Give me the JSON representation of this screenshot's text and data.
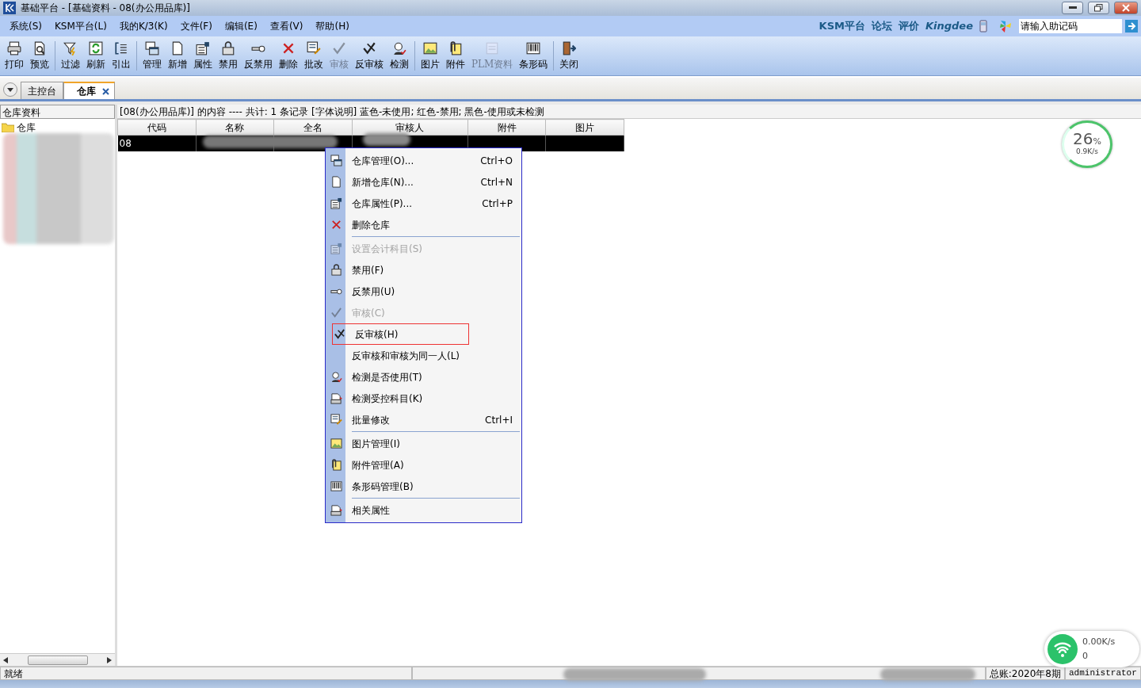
{
  "window": {
    "title": "基础平台 - [基础资料 - 08(办公用品库)]"
  },
  "menu_bar": [
    "系统(S)",
    "KSM平台(L)",
    "我的K/3(K)",
    "文件(F)",
    "编辑(E)",
    "查看(V)",
    "帮助(H)"
  ],
  "top_links": [
    "KSM平台",
    "论坛",
    "评价",
    "Kingdee"
  ],
  "mnemonic_field": {
    "value": "请输入助记码"
  },
  "toolbar": [
    {
      "kind": "button",
      "label": "打印",
      "disabled": false
    },
    {
      "kind": "button",
      "label": "预览",
      "disabled": false
    },
    {
      "kind": "separator"
    },
    {
      "kind": "button",
      "label": "过滤",
      "disabled": false
    },
    {
      "kind": "button",
      "label": "刷新",
      "disabled": false
    },
    {
      "kind": "button",
      "label": "引出",
      "disabled": false
    },
    {
      "kind": "separator"
    },
    {
      "kind": "button",
      "label": "管理",
      "disabled": false
    },
    {
      "kind": "button",
      "label": "新增",
      "disabled": false
    },
    {
      "kind": "button",
      "label": "属性",
      "disabled": false
    },
    {
      "kind": "button",
      "label": "禁用",
      "disabled": false
    },
    {
      "kind": "button",
      "label": "反禁用",
      "disabled": false
    },
    {
      "kind": "button",
      "label": "删除",
      "disabled": false
    },
    {
      "kind": "button",
      "label": "批改",
      "disabled": false
    },
    {
      "kind": "button",
      "label": "审核",
      "disabled": true
    },
    {
      "kind": "button",
      "label": "反审核",
      "disabled": false
    },
    {
      "kind": "button",
      "label": "检测",
      "disabled": false
    },
    {
      "kind": "separator"
    },
    {
      "kind": "button",
      "label": "图片",
      "disabled": false
    },
    {
      "kind": "button",
      "label": "附件",
      "disabled": false
    },
    {
      "kind": "button",
      "label": "PLM资料",
      "disabled": true
    },
    {
      "kind": "button",
      "label": "条形码",
      "disabled": false
    },
    {
      "kind": "separator"
    },
    {
      "kind": "button",
      "label": "关闭",
      "disabled": false
    }
  ],
  "tabs": [
    {
      "label": "主控台",
      "selected": false,
      "closable": false
    },
    {
      "label": "仓库",
      "selected": true,
      "closable": true
    }
  ],
  "sidebar": {
    "title": "仓库资料",
    "root": "仓库"
  },
  "content": {
    "summary": "[08(办公用品库)] 的内容 ---- 共计: 1 条记录  [字体说明] 蓝色-未使用; 红色-禁用; 黑色-使用或未检测",
    "table": {
      "columns": [
        "代码",
        "名称",
        "全名",
        "审核人",
        "附件",
        "图片"
      ],
      "rows": [
        {
          "selected": true,
          "cells": [
            "08"
          ]
        }
      ]
    }
  },
  "context_menu": [
    {
      "kind": "item",
      "label": "仓库管理(O)...",
      "shortcut": "Ctrl+O",
      "disabled": false,
      "outlined": false
    },
    {
      "kind": "item",
      "label": "新增仓库(N)...",
      "shortcut": "Ctrl+N",
      "disabled": false,
      "outlined": false
    },
    {
      "kind": "item",
      "label": "仓库属性(P)...",
      "shortcut": "Ctrl+P",
      "disabled": false,
      "outlined": false
    },
    {
      "kind": "item",
      "label": "删除仓库",
      "disabled": false,
      "outlined": false
    },
    {
      "kind": "separator"
    },
    {
      "kind": "item",
      "label": "设置会计科目(S)",
      "disabled": true,
      "outlined": false
    },
    {
      "kind": "item",
      "label": "禁用(F)",
      "disabled": false,
      "outlined": false
    },
    {
      "kind": "item",
      "label": "反禁用(U)",
      "disabled": false,
      "outlined": false
    },
    {
      "kind": "item",
      "label": "审核(C)",
      "disabled": true,
      "outlined": false
    },
    {
      "kind": "item",
      "label": "反审核(H)",
      "disabled": false,
      "outlined": true
    },
    {
      "kind": "item",
      "label": "反审核和审核为同一人(L)",
      "disabled": false,
      "outlined": false
    },
    {
      "kind": "item",
      "label": "检测是否使用(T)",
      "disabled": false,
      "outlined": false
    },
    {
      "kind": "item",
      "label": "检测受控科目(K)",
      "disabled": false,
      "outlined": false
    },
    {
      "kind": "item",
      "label": "批量修改",
      "shortcut": "Ctrl+I",
      "disabled": false,
      "outlined": false
    },
    {
      "kind": "separator"
    },
    {
      "kind": "item",
      "label": "图片管理(I)",
      "disabled": false,
      "outlined": false
    },
    {
      "kind": "item",
      "label": "附件管理(A)",
      "disabled": false,
      "outlined": false
    },
    {
      "kind": "item",
      "label": "条形码管理(B)",
      "disabled": false,
      "outlined": false
    },
    {
      "kind": "separator"
    },
    {
      "kind": "item",
      "label": "相关属性",
      "disabled": false,
      "outlined": false
    }
  ],
  "status_bar": {
    "state": "就绪",
    "ledger": "总账:2020年8期",
    "user": "administrator"
  },
  "speed_widget": {
    "percent": "26",
    "unit": "%",
    "speed": "0.9K/s"
  },
  "net_widget": {
    "speed": "0.00K/s",
    "count": "0"
  }
}
